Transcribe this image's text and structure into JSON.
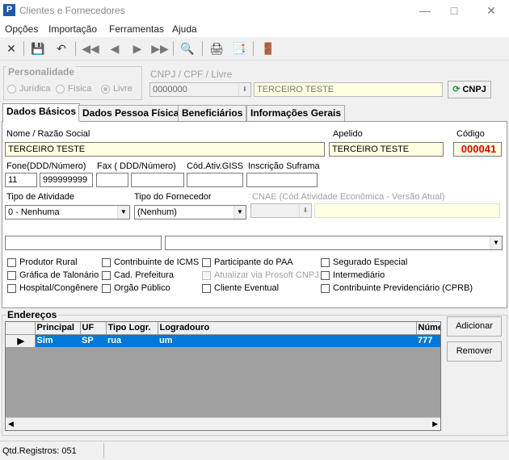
{
  "window": {
    "title": "Clientes e Fornecedores",
    "app_icon": "P"
  },
  "menu": [
    "Opções",
    "Importação",
    "Ferramentas",
    "Ajuda"
  ],
  "personalidade": {
    "title": "Personalidade",
    "options": [
      "Jurídica",
      "Física",
      "Livre"
    ],
    "selected": "Livre"
  },
  "cnpj": {
    "label": "CNPJ / CPF / Livre",
    "value": "0000000",
    "name_value": "TERCEIRO TESTE",
    "button": "CNPJ"
  },
  "tabs": [
    "Dados Básicos",
    "Dados Pessoa Física",
    "Beneficiários",
    "Informações Gerais"
  ],
  "basic": {
    "nome_label": "Nome / Razão Social",
    "nome_value": "TERCEIRO TESTE",
    "apelido_label": "Apelido",
    "apelido_value": "TERCEIRO TESTE",
    "codigo_label": "Código",
    "codigo_value": "000041",
    "fone_label": "Fone(DDD/Número)",
    "fone_ddd": "11",
    "fone_num": "999999999",
    "fax_label": "Fax ( DDD/Número)",
    "cod_giss_label": "Cód.Ativ.GISS",
    "suframa_label": "Inscrição Suframa",
    "tipo_atividade_label": "Tipo de Atividade",
    "tipo_atividade_value": "0 - Nenhuma",
    "tipo_fornecedor_label": "Tipo do Fornecedor",
    "tipo_fornecedor_value": "(Nenhum)",
    "cnae_label": "CNAE (Cód.Atividade Econômica - Versão Atual)"
  },
  "checkboxes": {
    "col1": [
      "Produtor Rural",
      "Gráfica de Talonário",
      "Hospital/Congênere"
    ],
    "col2": [
      "Contribuinte de ICMS",
      "Cad. Prefeitura",
      "Orgão Público"
    ],
    "col3": [
      "Participante do PAA",
      "Atualizar via Prosoft CNPJ",
      "Cliente Eventual"
    ],
    "col4": [
      "Segurado Especial",
      "Intermediário",
      "Contribuinte Previdenciário (CPRB)"
    ]
  },
  "enderecos": {
    "title": "Endereços",
    "columns": [
      "Principal",
      "UF",
      "Tipo Logr.",
      "Logradouro",
      "Núme"
    ],
    "rows": [
      [
        "Sim",
        "SP",
        "rua",
        "um",
        "777"
      ]
    ],
    "add_button": "Adicionar",
    "remove_button": "Remover"
  },
  "status": {
    "text": "Qtd.Registros: 051"
  },
  "colors": {
    "accent": "#0078d7",
    "code_red": "#e00000",
    "field_yellow": "#ffffe1"
  }
}
